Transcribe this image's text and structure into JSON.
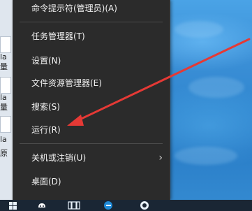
{
  "context_menu": {
    "items": [
      {
        "label": "命令提示符(管理员)(A)"
      },
      {
        "label": "任务管理器(T)"
      },
      {
        "label": "设置(N)"
      },
      {
        "label": "文件资源管理器(E)"
      },
      {
        "label": "搜索(S)"
      },
      {
        "label": "运行(R)"
      },
      {
        "label": "关机或注销(U)",
        "has_submenu": true,
        "submenu_glyph": "›"
      },
      {
        "label": "桌面(D)"
      }
    ]
  },
  "desktop": {
    "left_strip_labels": [
      "la",
      "量",
      "la",
      "量",
      "la",
      "原"
    ]
  },
  "colors": {
    "menu_bg": "#2b2b2b",
    "menu_text": "#f2f2f2",
    "arrow": "#e53935",
    "taskbar_bg": "#1a2634"
  },
  "taskbar": {
    "icons": [
      "start-icon",
      "cortana-icon",
      "task-view-icon",
      "edge-icon",
      "app-icon"
    ]
  }
}
